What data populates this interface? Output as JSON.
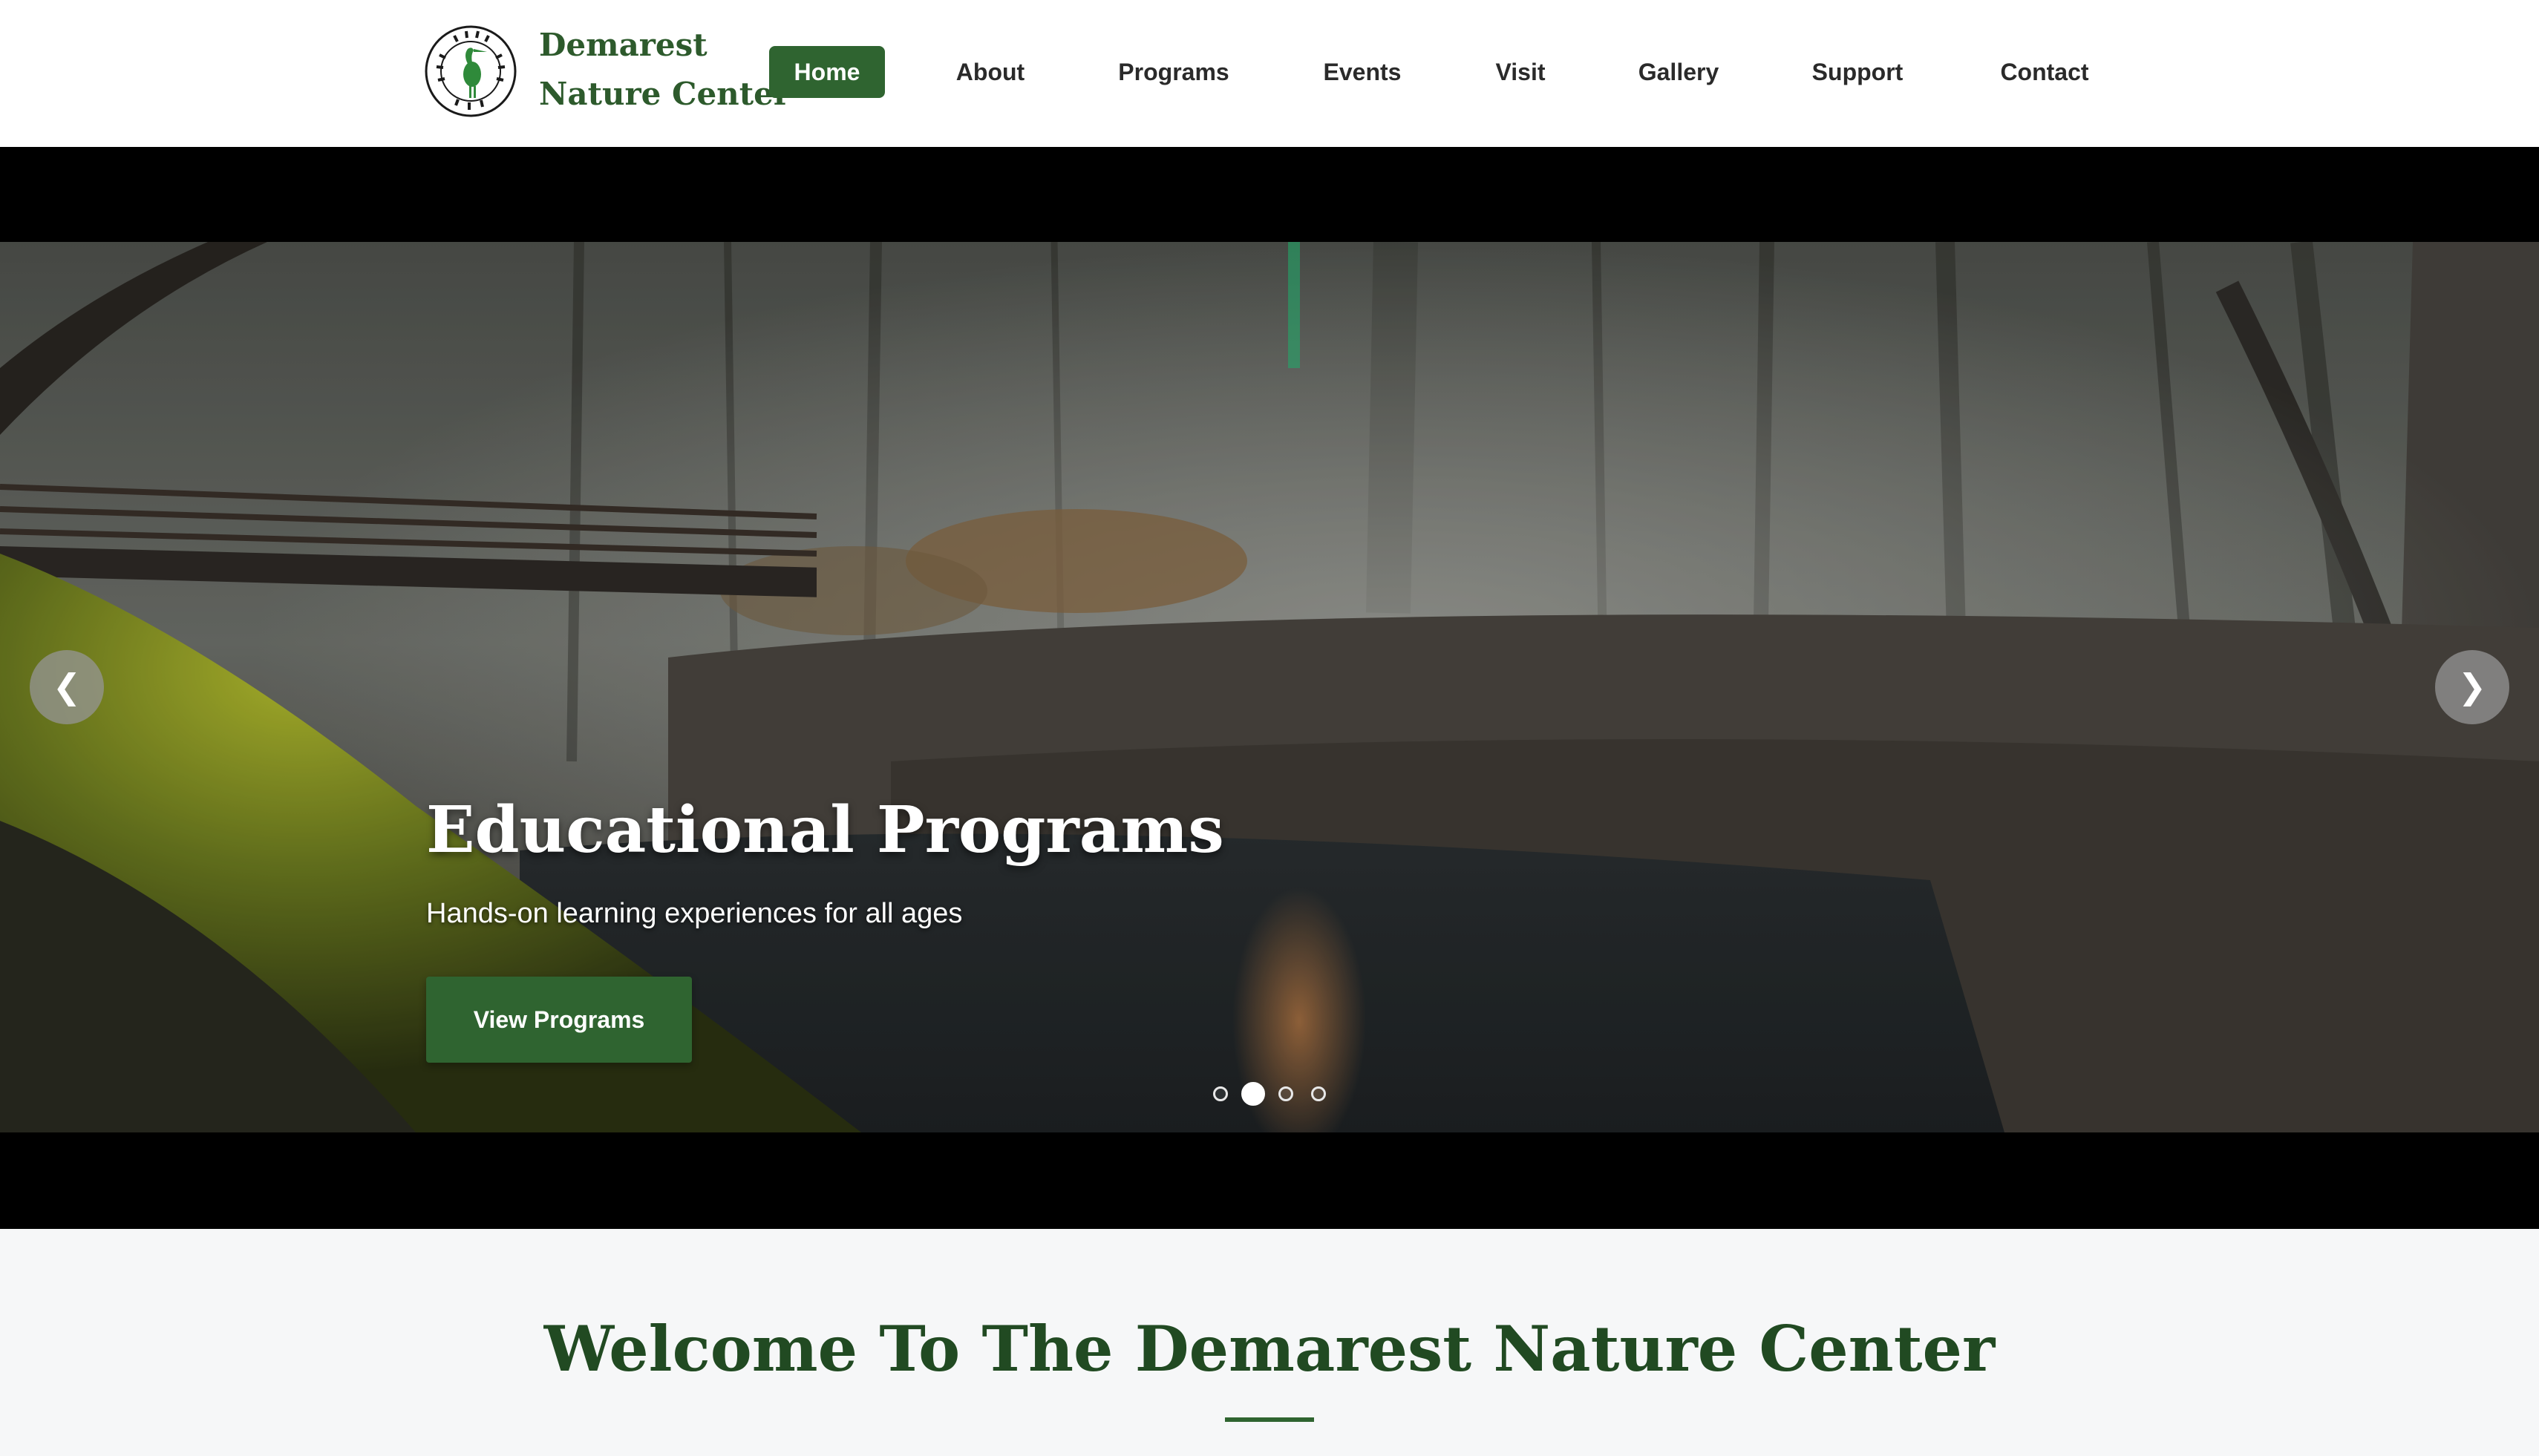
{
  "site": {
    "brand_line1": "Demarest",
    "brand_line2": "Nature Center",
    "logo_icon": "heron-seal-icon",
    "colors": {
      "brand_green": "#2f6430",
      "heading_green": "#214a22"
    }
  },
  "nav": {
    "items": [
      {
        "label": "Home",
        "active": true
      },
      {
        "label": "About",
        "active": false
      },
      {
        "label": "Programs",
        "active": false
      },
      {
        "label": "Events",
        "active": false
      },
      {
        "label": "Visit",
        "active": false
      },
      {
        "label": "Gallery",
        "active": false
      },
      {
        "label": "Support",
        "active": false
      },
      {
        "label": "Contact",
        "active": false
      }
    ]
  },
  "hero": {
    "slide_title": "Educational Programs",
    "slide_subtitle": "Hands-on learning experiences for all ages",
    "cta_label": "View Programs",
    "prev_label": "❮",
    "next_label": "❯",
    "slide_count": 4,
    "active_slide": 2
  },
  "welcome": {
    "title": "Welcome To The Demarest Nature Center"
  }
}
